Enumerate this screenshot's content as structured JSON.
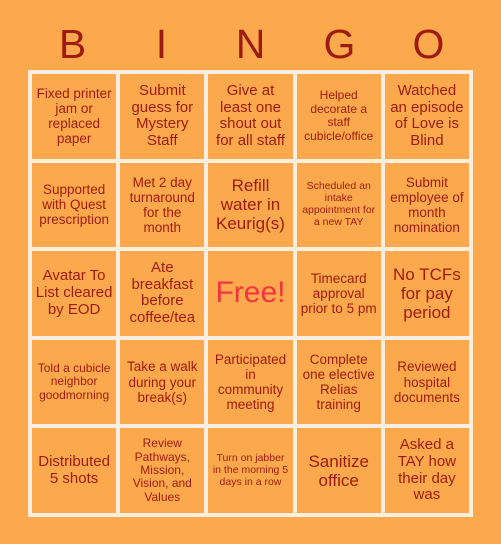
{
  "header": {
    "letters": [
      "B",
      "I",
      "N",
      "G",
      "O"
    ]
  },
  "colors": {
    "background": "#fca94d",
    "cell_background": "#fca94d",
    "grid_line": "#fdeee2",
    "text": "#9e1b11",
    "free_text": "#f5333f"
  },
  "grid": {
    "columns": 5,
    "rows": 5,
    "cells": [
      {
        "text": "Fixed printer jam or replaced paper",
        "size": "fs-m",
        "free": false
      },
      {
        "text": "Submit guess for Mystery Staff",
        "size": "fs-l",
        "free": false
      },
      {
        "text": "Give at least one shout out for all staff",
        "size": "fs-l",
        "free": false
      },
      {
        "text": "Helped decorate a staff cubicle/office",
        "size": "fs-s",
        "free": false
      },
      {
        "text": "Watched an episode of Love is Blind",
        "size": "fs-l",
        "free": false
      },
      {
        "text": "Supported with Quest prescription",
        "size": "fs-m",
        "free": false
      },
      {
        "text": "Met 2 day turnaround for the month",
        "size": "fs-m",
        "free": false
      },
      {
        "text": "Refill water in Keurig(s)",
        "size": "fs-xl",
        "free": false
      },
      {
        "text": "Scheduled an intake appointment for a new TAY",
        "size": "fs-xs",
        "free": false
      },
      {
        "text": "Submit employee of month nomination",
        "size": "fs-m",
        "free": false
      },
      {
        "text": "Avatar To List cleared by EOD",
        "size": "fs-l",
        "free": false
      },
      {
        "text": "Ate breakfast before coffee/tea",
        "size": "fs-l",
        "free": false
      },
      {
        "text": "Free!",
        "size": "fs-xl",
        "free": true
      },
      {
        "text": "Timecard approval prior to 5 pm",
        "size": "fs-m",
        "free": false
      },
      {
        "text": "No TCFs for pay period",
        "size": "fs-xl",
        "free": false
      },
      {
        "text": "Told a cubicle neighbor goodmorning",
        "size": "fs-s",
        "free": false
      },
      {
        "text": "Take a walk during your break(s)",
        "size": "fs-m",
        "free": false
      },
      {
        "text": "Participated in community meeting",
        "size": "fs-m",
        "free": false
      },
      {
        "text": "Complete one elective Relias training",
        "size": "fs-m",
        "free": false
      },
      {
        "text": "Reviewed hospital documents",
        "size": "fs-m",
        "free": false
      },
      {
        "text": "Distributed 5 shots",
        "size": "fs-l",
        "free": false
      },
      {
        "text": "Review Pathways, Mission, Vision, and Values",
        "size": "fs-s",
        "free": false
      },
      {
        "text": "Turn on jabber in the morning 5 days in a row",
        "size": "fs-xs",
        "free": false
      },
      {
        "text": "Sanitize office",
        "size": "fs-xl",
        "free": false
      },
      {
        "text": "Asked a TAY how their day was",
        "size": "fs-l",
        "free": false
      }
    ]
  }
}
